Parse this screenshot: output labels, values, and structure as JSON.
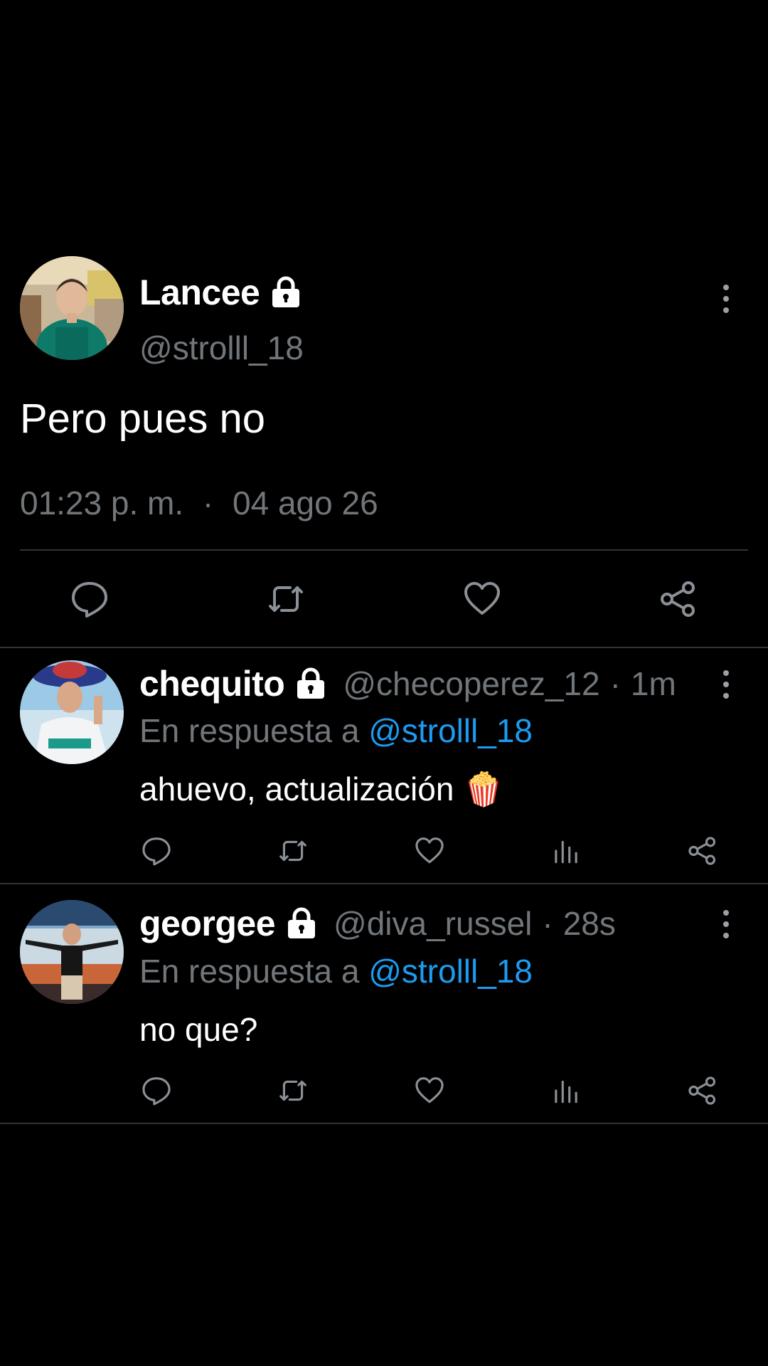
{
  "main_tweet": {
    "display_name": "Lancee",
    "handle": "@strolll_18",
    "text": "Pero pues no",
    "time": "01:23 p. m.",
    "date": "04 ago 26",
    "separator": "·"
  },
  "replies": [
    {
      "display_name": "chequito",
      "handle": "@checoperez_12",
      "age": "1m",
      "reply_prefix": "En respuesta a",
      "reply_to": "@strolll_18",
      "text": "ahuevo, actualización 🍿",
      "separator": "·"
    },
    {
      "display_name": "georgee",
      "handle": "@diva_russel",
      "age": "28s",
      "reply_prefix": "En respuesta a",
      "reply_to": "@strolll_18",
      "text": "no que?",
      "separator": "·"
    }
  ],
  "icons": {
    "reply": "comment-bubble-icon",
    "retweet": "retweet-icon",
    "like": "heart-icon",
    "views": "analytics-icon",
    "share": "share-icon",
    "protected": "lock-icon",
    "more": "more-vertical-icon"
  },
  "colors": {
    "background": "#000000",
    "primary_text": "#ffffff",
    "secondary_text": "#71767b",
    "mention": "#1d9bf0",
    "divider": "#2f3336"
  }
}
